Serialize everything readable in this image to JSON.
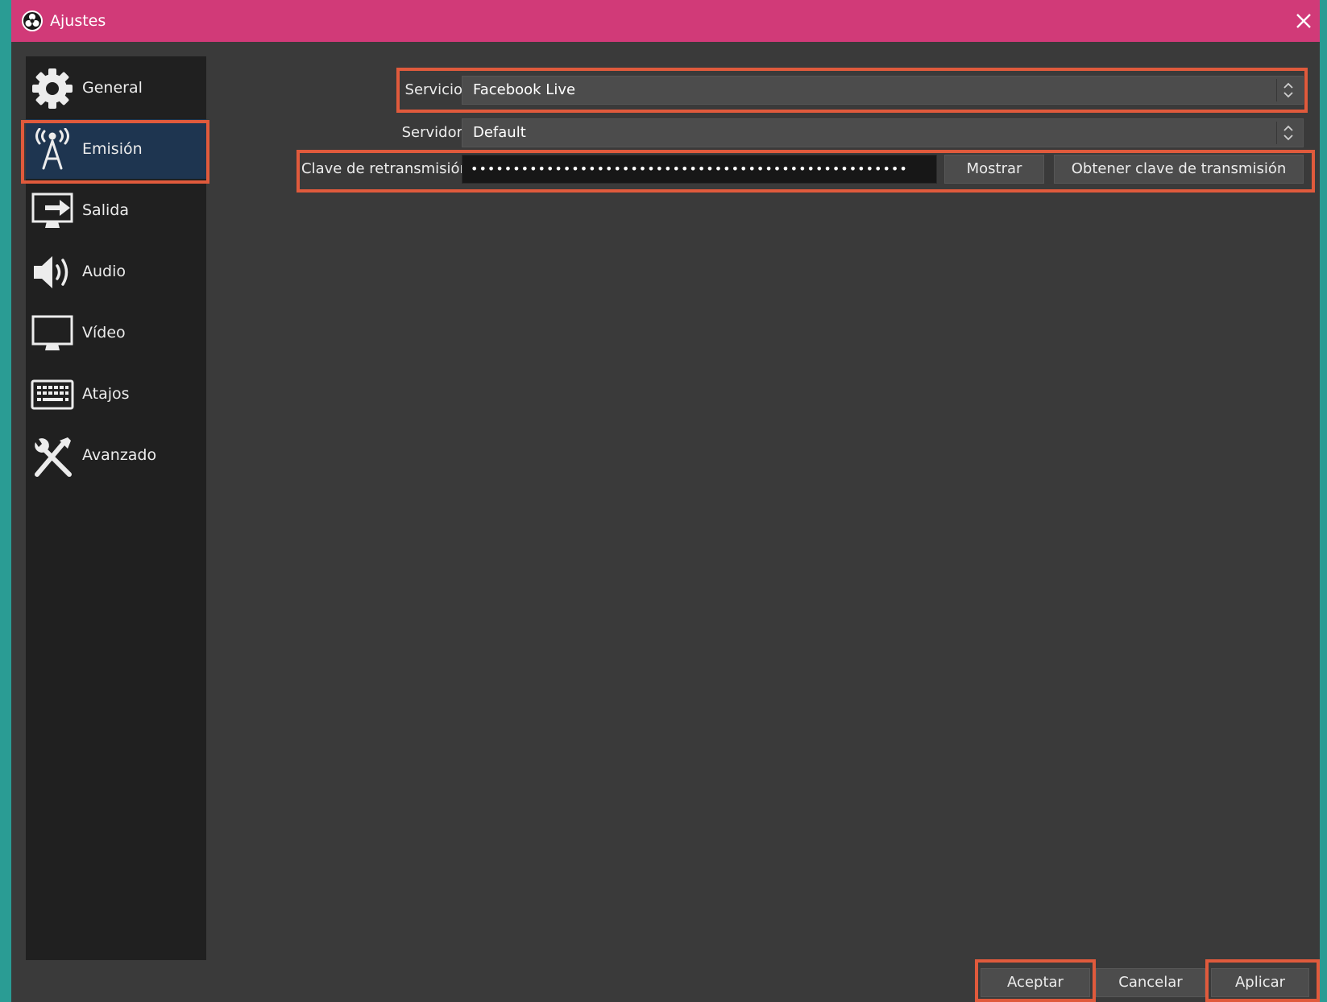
{
  "window": {
    "title": "Ajustes"
  },
  "sidebar": {
    "items": [
      {
        "label": "General",
        "icon": "gear-icon"
      },
      {
        "label": "Emisión",
        "icon": "broadcast-tower-icon",
        "active": true
      },
      {
        "label": "Salida",
        "icon": "output-monitor-icon"
      },
      {
        "label": "Audio",
        "icon": "speaker-icon"
      },
      {
        "label": "Vídeo",
        "icon": "monitor-icon"
      },
      {
        "label": "Atajos",
        "icon": "keyboard-icon"
      },
      {
        "label": "Avanzado",
        "icon": "tools-icon"
      }
    ]
  },
  "stream": {
    "service_label": "Servicio",
    "service_value": "Facebook Live",
    "server_label": "Servidor",
    "server_value": "Default",
    "key_label": "Clave de retransmisión",
    "key_value": "••••••••••••••••••••••••••••••••••••••••••••••••••••",
    "show_label": "Mostrar",
    "get_key_label": "Obtener clave de transmisión"
  },
  "footer": {
    "accept": "Aceptar",
    "cancel": "Cancelar",
    "apply": "Aplicar"
  },
  "colors": {
    "titlebar": "#d13a78",
    "highlight": "#e05a3c",
    "active_item": "#1e3550",
    "background": "#3a3a3a"
  }
}
